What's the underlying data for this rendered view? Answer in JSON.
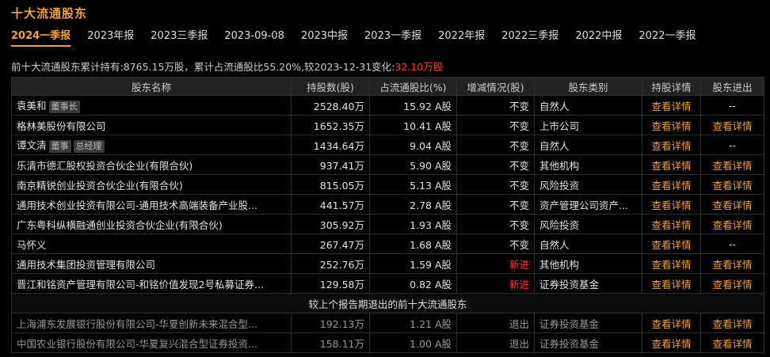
{
  "page": {
    "title": "十大流通股东"
  },
  "tabs": [
    "2024一季报",
    "2023年报",
    "2023三季报",
    "2023-09-08",
    "2023中报",
    "2023一季报",
    "2022年报",
    "2022三季报",
    "2022中报",
    "2022一季报"
  ],
  "summary": {
    "prefix": "前十大流通股东累计持有:8765.15万股，累计占流通股比55.20%,较2023-12-31变化:",
    "change": "32.10万股"
  },
  "table": {
    "headers": [
      "股东名称",
      "持股数(股)",
      "占流通股比(%)",
      "增减情况(股)",
      "股东类别",
      "持股详情",
      "股东进出"
    ],
    "rows": [
      {
        "name": "袁美和",
        "tags": [
          "董事长"
        ],
        "shares": "2528.40万",
        "ratio": "15.92 A股",
        "change": "不变",
        "type": "自然人",
        "detail": "查看详情",
        "io": "--"
      },
      {
        "name": "格林美股份有限公司",
        "tags": [],
        "shares": "1652.35万",
        "ratio": "10.41 A股",
        "change": "不变",
        "type": "上市公司",
        "detail": "查看详情",
        "io": "查看详情"
      },
      {
        "name": "谭文清",
        "tags": [
          "董事",
          "总经理"
        ],
        "shares": "1434.64万",
        "ratio": "9.04 A股",
        "change": "不变",
        "type": "自然人",
        "detail": "查看详情",
        "io": "--"
      },
      {
        "name": "乐清市德汇股权投资合伙企业(有限合伙)",
        "tags": [],
        "shares": "937.41万",
        "ratio": "5.90 A股",
        "change": "不变",
        "type": "其他机构",
        "detail": "查看详情",
        "io": "查看详情"
      },
      {
        "name": "南京精锐创业投资合伙企业(有限合伙)",
        "tags": [],
        "shares": "815.05万",
        "ratio": "5.13 A股",
        "change": "不变",
        "type": "风险投资",
        "detail": "查看详情",
        "io": "查看详情"
      },
      {
        "name": "通用技术创业投资有限公司-通用技术高端装备产业股...",
        "tags": [],
        "shares": "441.57万",
        "ratio": "2.78 A股",
        "change": "不变",
        "type": "资产管理公司资产...",
        "detail": "查看详情",
        "io": "查看详情"
      },
      {
        "name": "广东粤科纵横融通创业投资合伙企业(有限合伙)",
        "tags": [],
        "shares": "305.92万",
        "ratio": "1.93 A股",
        "change": "不变",
        "type": "风险投资",
        "detail": "查看详情",
        "io": "查看详情"
      },
      {
        "name": "马怀义",
        "tags": [],
        "shares": "267.47万",
        "ratio": "1.68 A股",
        "change": "不变",
        "type": "自然人",
        "detail": "查看详情",
        "io": "--"
      },
      {
        "name": "通用技术集团投资管理有限公司",
        "tags": [],
        "shares": "252.76万",
        "ratio": "1.59 A股",
        "change": "新进",
        "type": "其他机构",
        "detail": "查看详情",
        "io": "查看详情"
      },
      {
        "name": "晋江和铭资产管理有限公司-和铭价值发现2号私募证券...",
        "tags": [],
        "shares": "129.58万",
        "ratio": "0.82 A股",
        "change": "新进",
        "type": "证券投资基金",
        "detail": "查看详情",
        "io": "查看详情"
      }
    ],
    "section_label": "较上个报告期退出的前十大流通股东",
    "exited_rows": [
      {
        "name": "上海浦东发展银行股份有限公司-华夏创新未来混合型...",
        "shares": "192.13万",
        "ratio": "1.21 A股",
        "change": "退出",
        "type": "证券投资基金",
        "detail": "查看详情",
        "io": "查看详情"
      },
      {
        "name": "中国农业银行股份有限公司-华夏复兴混合型证券投资...",
        "shares": "158.11万",
        "ratio": "1.00 A股",
        "change": "退出",
        "type": "证券投资基金",
        "detail": "查看详情",
        "io": "查看详情"
      }
    ]
  }
}
